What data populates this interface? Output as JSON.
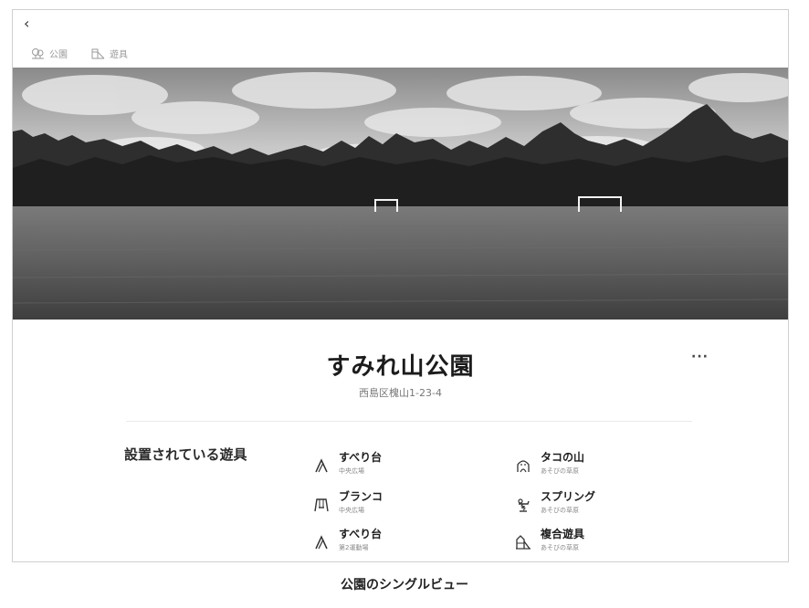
{
  "header": {
    "back_label": "‹",
    "tabs": [
      {
        "label": "公園",
        "icon": "park-icon"
      },
      {
        "label": "遊具",
        "icon": "playground-icon"
      }
    ]
  },
  "hero": {
    "icon": "park-field-photo"
  },
  "park": {
    "name": "すみれ山公園",
    "address": "西島区槐山1-23-4",
    "more_label": "···"
  },
  "equipment": {
    "heading": "設置されている遊具",
    "items": [
      {
        "name": "すべり台",
        "location": "中央広場",
        "icon": "slide-icon"
      },
      {
        "name": "タコの山",
        "location": "あそびの草原",
        "icon": "octopus-mountain-icon"
      },
      {
        "name": "ブランコ",
        "location": "中央広場",
        "icon": "swing-icon"
      },
      {
        "name": "スプリング",
        "location": "あそびの草原",
        "icon": "spring-rider-icon"
      },
      {
        "name": "すべり台",
        "location": "第2運動場",
        "icon": "slide-icon"
      },
      {
        "name": "複合遊具",
        "location": "あそびの草原",
        "icon": "combination-play-icon"
      }
    ]
  },
  "caption": "公園のシングルビュー"
}
